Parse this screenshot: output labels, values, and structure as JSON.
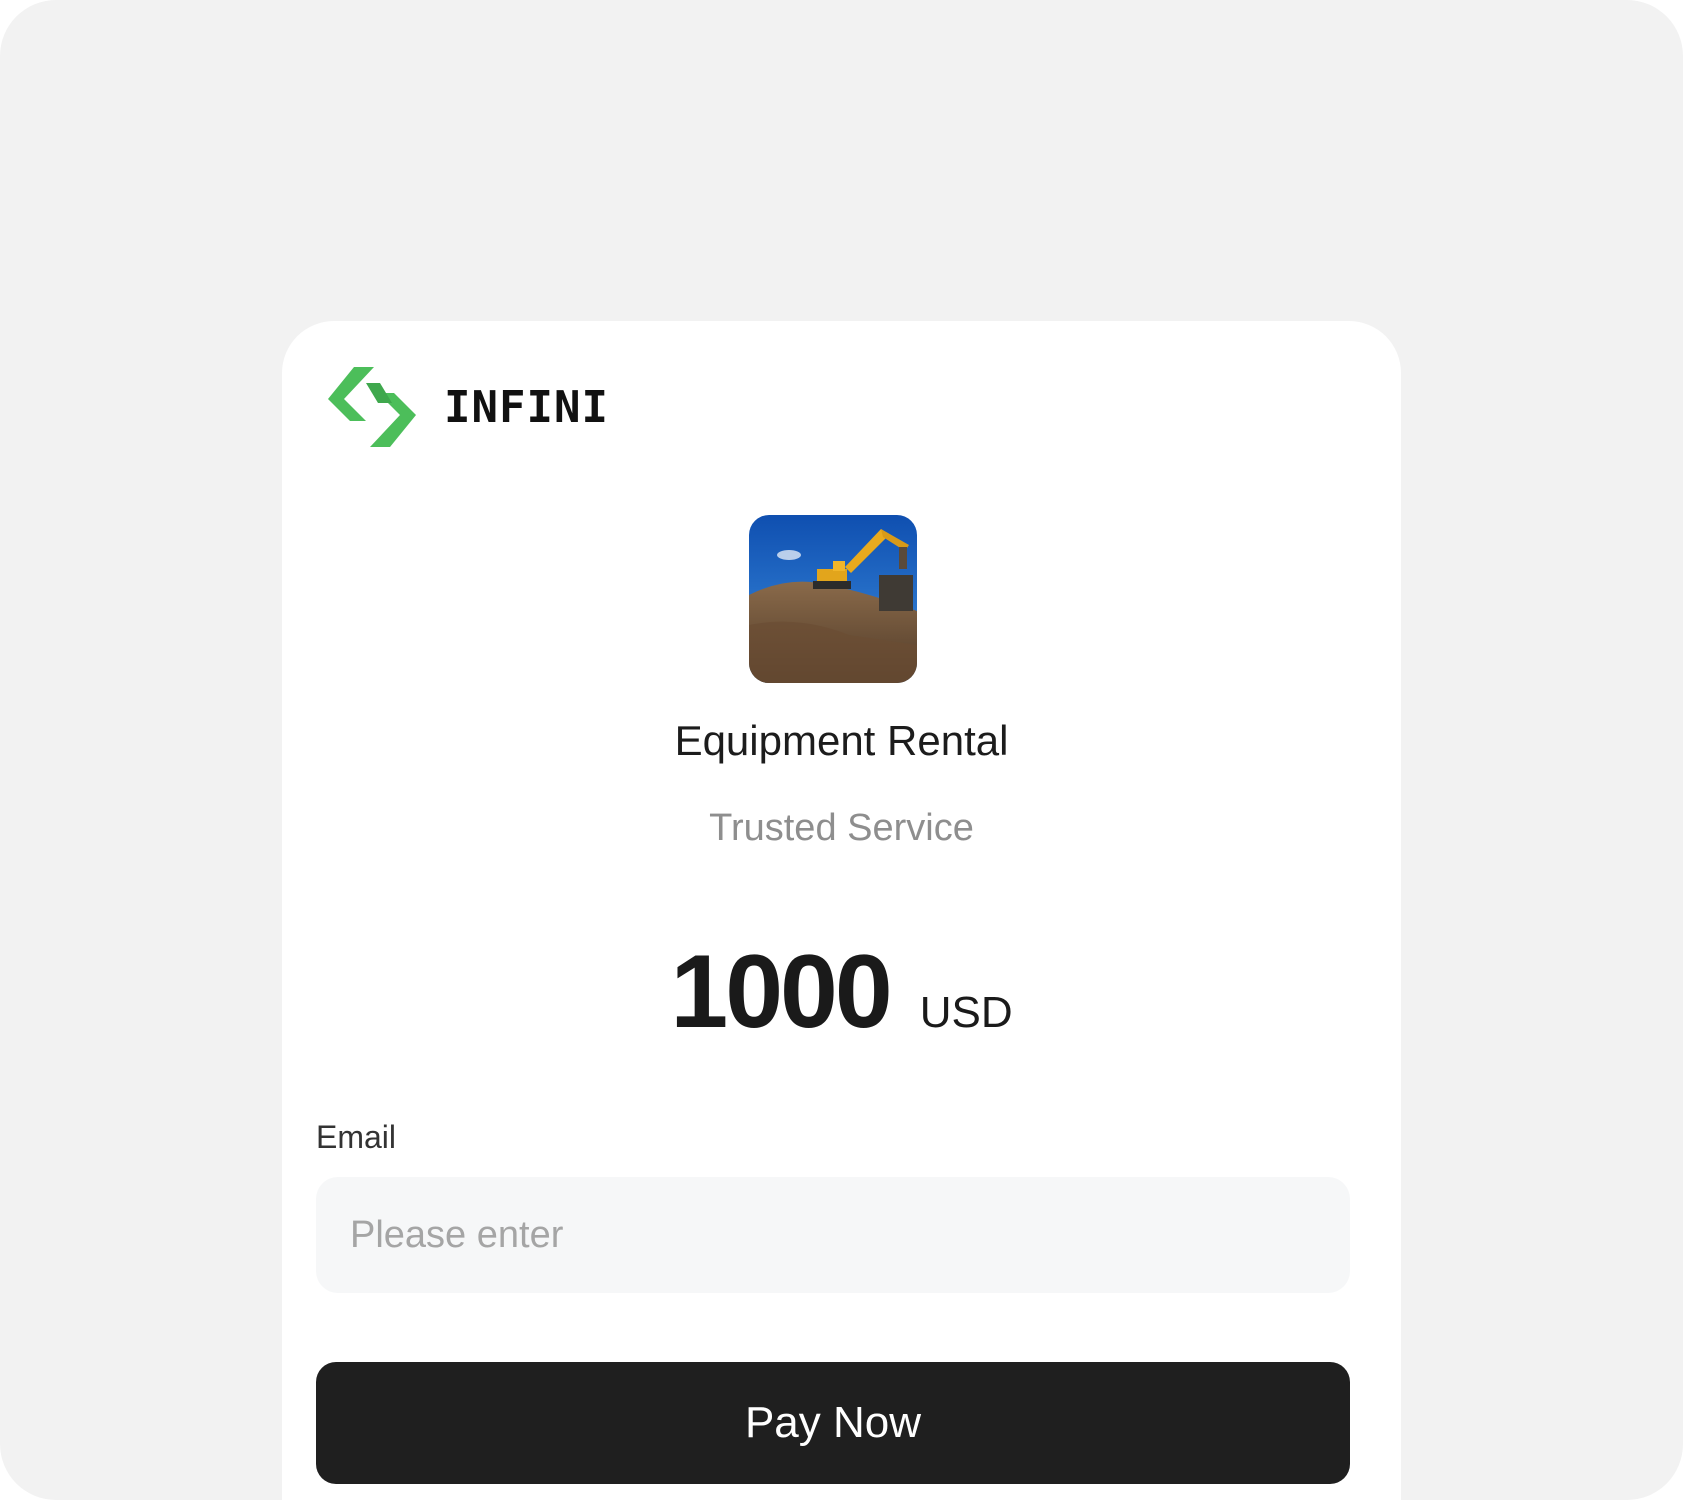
{
  "brand": {
    "name": "INFINI",
    "logo_color": "#4cbe5a"
  },
  "product": {
    "image_icon": "excavator-photo",
    "name": "Equipment Rental",
    "subtitle": "Trusted Service"
  },
  "price": {
    "amount": "1000",
    "currency": "USD"
  },
  "form": {
    "email_label": "Email",
    "email_placeholder": "Please enter",
    "email_value": ""
  },
  "actions": {
    "pay_label": "Pay Now",
    "pay_color": "#1f1f1f"
  }
}
